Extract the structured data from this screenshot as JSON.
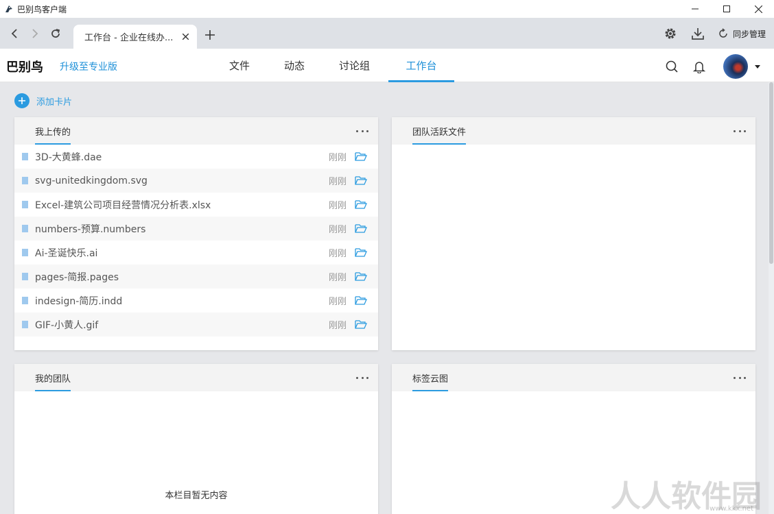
{
  "window": {
    "title": "巴别鸟客户端"
  },
  "browser": {
    "tab_title": "工作台 - 企业在线办...",
    "sync_label": "同步管理"
  },
  "app": {
    "logo": "巴别鸟",
    "upgrade": "升级至专业版",
    "nav": [
      {
        "label": "文件",
        "active": false
      },
      {
        "label": "动态",
        "active": false
      },
      {
        "label": "讨论组",
        "active": false
      },
      {
        "label": "工作台",
        "active": true
      }
    ],
    "accent_color": "#2b9be0"
  },
  "workspace": {
    "add_card": "添加卡片",
    "cards": {
      "my_uploads": {
        "title": "我上传的",
        "files": [
          {
            "name": "3D-大黄蜂.dae",
            "time": "刚刚"
          },
          {
            "name": "svg-unitedkingdom.svg",
            "time": "刚刚"
          },
          {
            "name": "Excel-建筑公司项目经营情况分析表.xlsx",
            "time": "刚刚"
          },
          {
            "name": "numbers-预算.numbers",
            "time": "刚刚"
          },
          {
            "name": "Ai-圣诞快乐.ai",
            "time": "刚刚"
          },
          {
            "name": "pages-简报.pages",
            "time": "刚刚"
          },
          {
            "name": "indesign-简历.indd",
            "time": "刚刚"
          },
          {
            "name": "GIF-小黄人.gif",
            "time": "刚刚"
          }
        ]
      },
      "team_active": {
        "title": "团队活跃文件"
      },
      "my_team": {
        "title": "我的团队",
        "empty": "本栏目暂无内容"
      },
      "tag_cloud": {
        "title": "标签云图"
      }
    }
  },
  "watermark": {
    "text": "人人软件园",
    "url": "www.kkx.net"
  }
}
